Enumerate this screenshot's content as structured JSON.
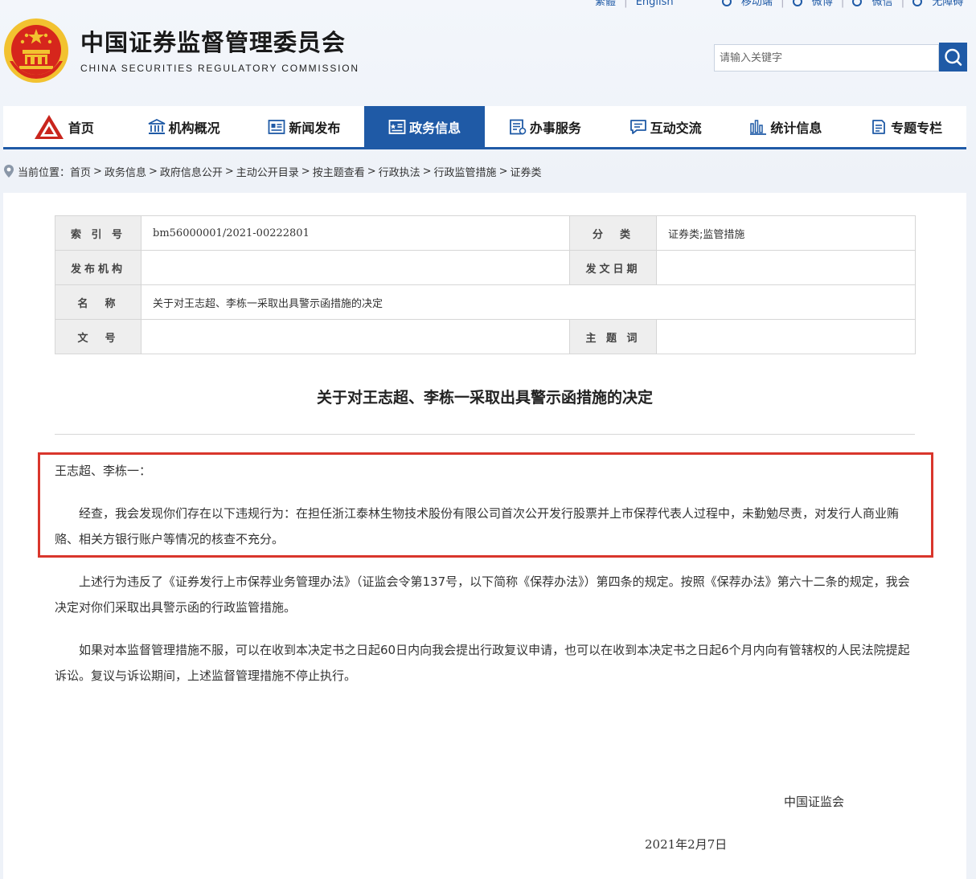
{
  "header": {
    "title": "中国证券监督管理委员会",
    "subtitle": "CHINA SECURITIES REGULATORY COMMISSION",
    "top_links": [
      "繁體",
      "English",
      "移动端",
      "微博",
      "微信",
      "无障碍"
    ],
    "search": {
      "placeholder": "请输入关键字"
    }
  },
  "nav": {
    "items": [
      {
        "label": "首页",
        "icon": "logo-icon"
      },
      {
        "label": "机构概况",
        "icon": "building-icon"
      },
      {
        "label": "新闻发布",
        "icon": "news-icon"
      },
      {
        "label": "政务信息",
        "icon": "gov-info-icon",
        "active": true
      },
      {
        "label": "办事服务",
        "icon": "service-icon"
      },
      {
        "label": "互动交流",
        "icon": "chat-icon"
      },
      {
        "label": "统计信息",
        "icon": "bar-chart-icon"
      },
      {
        "label": "专题专栏",
        "icon": "document-icon"
      }
    ]
  },
  "breadcrumb": {
    "prefix": "当前位置：",
    "items": [
      "首页",
      "政务信息",
      "政府信息公开",
      "主动公开目录",
      "按主题查看",
      "行政执法",
      "行政监管措施",
      "证券类"
    ]
  },
  "meta": {
    "index_label": "索 引 号",
    "index_value": "bm56000001/2021-00222801",
    "category_label": "分　类",
    "category_value": "证券类;监管措施",
    "publisher_label": "发布机构",
    "publisher_value": "",
    "date_label": "发文日期",
    "date_value": "",
    "name_label": "名　称",
    "name_value": "关于对王志超、李栋一采取出具警示函措施的决定",
    "docno_label": "文　号",
    "docno_value": "",
    "keyword_label": "主 题 词",
    "keyword_value": ""
  },
  "document": {
    "title": "关于对王志超、李栋一采取出具警示函措施的决定",
    "salutation": "王志超、李栋一：",
    "p1": "经查，我会发现你们存在以下违规行为：在担任浙江泰林生物技术股份有限公司首次公开发行股票并上市保荐代表人过程中，未勤勉尽责，对发行人商业贿赂、相关方银行账户等情况的核查不充分。",
    "p2": "上述行为违反了《证券发行上市保荐业务管理办法》（证监会令第137号，以下简称《保荐办法》）第四条的规定。按照《保荐办法》第六十二条的规定，我会决定对你们采取出具警示函的行政监管措施。",
    "p3": "如果对本监督管理措施不服，可以在收到本决定书之日起60日内向我会提出行政复议申请，也可以在收到本决定书之日起6个月内向有管辖权的人民法院提起诉讼。复议与诉讼期间，上述监督管理措施不停止执行。",
    "signer": "中国证监会",
    "date": "2021年2月7日"
  },
  "colors": {
    "primary": "#1f5aa6",
    "highlight": "#d9362c",
    "emblem_red": "#d6261c",
    "emblem_gold": "#f2c230"
  }
}
